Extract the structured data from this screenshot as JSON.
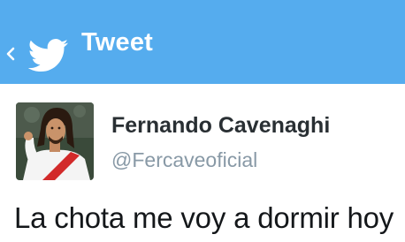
{
  "header": {
    "title": "Tweet",
    "back_icon": "chevron-left-icon",
    "logo_icon": "twitter-bird-icon",
    "background_color": "#55acee"
  },
  "tweet": {
    "author": {
      "display_name": "Fernando Cavenaghi",
      "handle": "@Fercaveoficial"
    },
    "text": "La chota me voy a dormir hoy"
  }
}
